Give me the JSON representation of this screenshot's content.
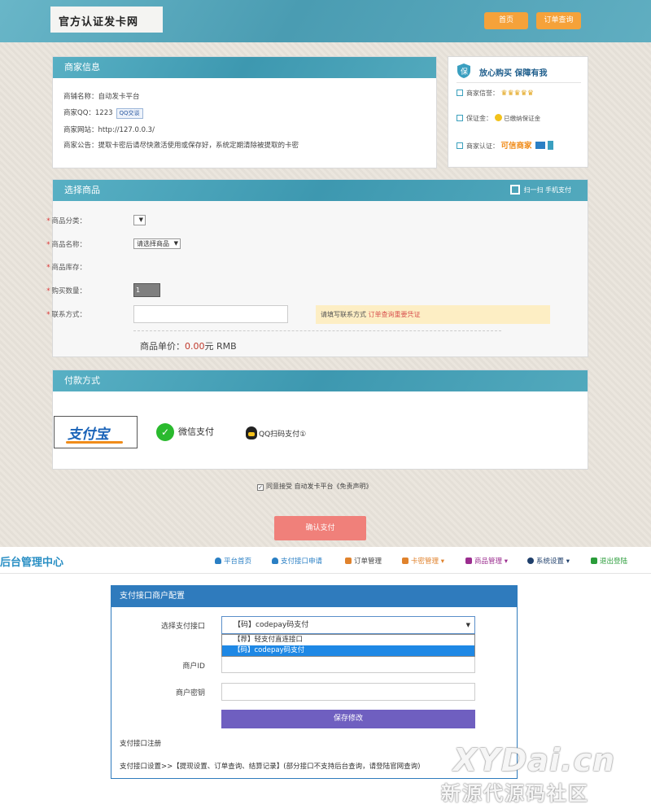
{
  "store": {
    "logo": "官方认证发卡网",
    "nav": {
      "home": "首页",
      "order_query": "订单查询"
    },
    "merchant": {
      "title": "商家信息",
      "shop_name": "商铺名称：自动发卡平台",
      "qq": "商家QQ：1223",
      "qq_badge": "QQ交谈",
      "site": "商家网站：http://127.0.0.3/",
      "notice": "商家公告：提取卡密后请尽快激活使用或保存好，系统定期清除被提取的卡密"
    },
    "trust": {
      "title": "放心购买  保障有我",
      "credit": "商家信誉：",
      "deposit": "保证金：",
      "deposit_value": "已缴纳保证金",
      "cert": "商家认证：",
      "cert_value": "可信商家"
    },
    "select": {
      "title": "选择商品",
      "scan": "扫一扫 手机支付",
      "category_label": "商品分类：",
      "name_label": "商品名称：",
      "name_value": "请选择商品",
      "stock_label": "商品库存：",
      "qty_label": "购买数量：",
      "qty_value": "1",
      "contact_label": "联系方式：",
      "hint": "请填写联系方式 ",
      "hint_em": "订单查询重要凭证",
      "price_prefix": "商品单价：",
      "price_value": "0.00",
      "price_suffix": "元 RMB"
    },
    "payment": {
      "title": "付款方式",
      "alipay": "支付宝",
      "wechat": "微信支付",
      "qq": "QQ扫码支付①"
    },
    "agree": "同意接受 自动发卡平台《免责声明》",
    "confirm": "确认支付"
  },
  "admin": {
    "brand": "后台管理中心",
    "nav": [
      {
        "label": "平台首页",
        "color": "#2a7fc4"
      },
      {
        "label": "支付接口申请",
        "color": "#2a7fc4"
      },
      {
        "label": "订单管理",
        "color": "#444444"
      },
      {
        "label": "卡密管理 ▾",
        "color": "#e0822c"
      },
      {
        "label": "商品管理 ▾",
        "color": "#9b2d8f"
      },
      {
        "label": "系统设置 ▾",
        "color": "#1f3f6b"
      },
      {
        "label": "退出登陆",
        "color": "#2a9c3a"
      }
    ],
    "card": {
      "title": "支付接口商户配置",
      "select_label": "选择支付接口",
      "select_value": "【码】codepay码支付",
      "options": [
        "【荐】轻支付直连接口",
        "【码】codepay码支付"
      ],
      "merchant_id_label": "商户ID",
      "merchant_key_label": "商户密钥",
      "save": "保存修改",
      "register": "支付接口注册",
      "note": "支付接口设置>>【提现设置、订单查询、结算记录】(部分接口不支持后台查询，请登陆官网查询)"
    }
  },
  "watermark": {
    "line1": "XYDai.cn",
    "line2": "新源代源码社区"
  }
}
